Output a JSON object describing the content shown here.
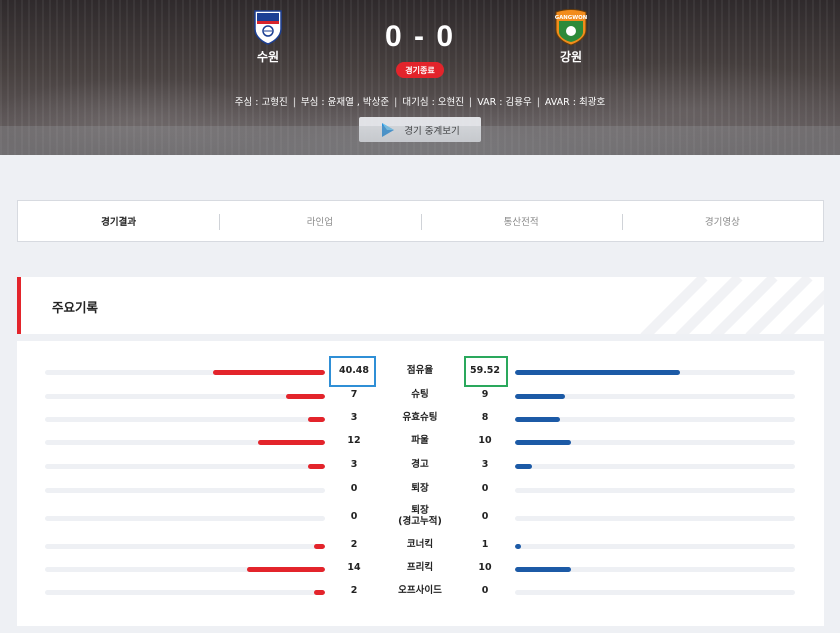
{
  "match": {
    "home_team": "수원",
    "away_team": "강원",
    "home_score": "0",
    "away_score": "0",
    "score_sep": "-",
    "status": "경기종료",
    "home_crest_icon": "suwon-crest-icon",
    "away_crest_icon": "gangwon-crest-icon",
    "away_crest_text": "GANGWON"
  },
  "officials": [
    "주심 : 고형진",
    "부심 : 윤재열 , 박상준",
    "대기심 : 오현진",
    "VAR : 김용우",
    "AVAR : 최광호"
  ],
  "watch_button": {
    "label": "경기 중계보기",
    "icon": "play-icon"
  },
  "tabs": [
    {
      "label": "경기결과",
      "active": true
    },
    {
      "label": "라인업",
      "active": false
    },
    {
      "label": "통산전적",
      "active": false
    },
    {
      "label": "경기영상",
      "active": false
    }
  ],
  "section": {
    "title": "주요기록"
  },
  "colors": {
    "home_bar": "#e3242b",
    "away_bar": "#1c5aa6",
    "accent": "#e3242b",
    "home_highlight": "#2f8fd6",
    "away_highlight": "#2aa85c"
  },
  "stats": [
    {
      "label": "점유율",
      "home": "40.48",
      "away": "59.52",
      "home_fill": 0.4,
      "away_fill": 0.59
    },
    {
      "label": "슈팅",
      "home": "7",
      "away": "9",
      "home_fill": 0.14,
      "away_fill": 0.18
    },
    {
      "label": "유효슈팅",
      "home": "3",
      "away": "8",
      "home_fill": 0.06,
      "away_fill": 0.16
    },
    {
      "label": "파울",
      "home": "12",
      "away": "10",
      "home_fill": 0.24,
      "away_fill": 0.2
    },
    {
      "label": "경고",
      "home": "3",
      "away": "3",
      "home_fill": 0.06,
      "away_fill": 0.06
    },
    {
      "label": "퇴장",
      "home": "0",
      "away": "0",
      "home_fill": 0,
      "away_fill": 0
    },
    {
      "label": "퇴장\n(경고누적)",
      "home": "0",
      "away": "0",
      "home_fill": 0,
      "away_fill": 0
    },
    {
      "label": "코너킥",
      "home": "2",
      "away": "1",
      "home_fill": 0.04,
      "away_fill": 0.02
    },
    {
      "label": "프리킥",
      "home": "14",
      "away": "10",
      "home_fill": 0.28,
      "away_fill": 0.2
    },
    {
      "label": "오프사이드",
      "home": "2",
      "away": "0",
      "home_fill": 0.04,
      "away_fill": 0
    }
  ]
}
